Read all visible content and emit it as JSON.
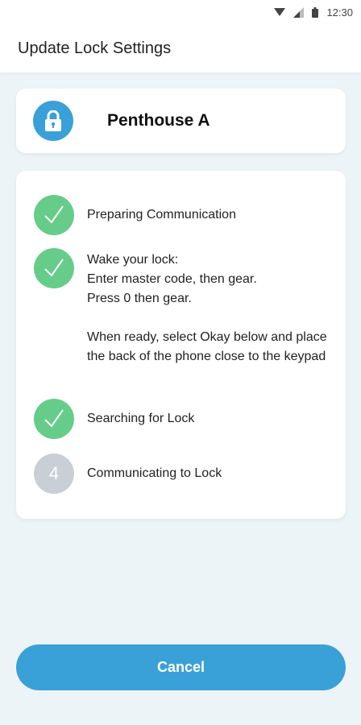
{
  "status_bar": {
    "time": "12:30",
    "icons": [
      "wifi-icon",
      "signal-icon",
      "battery-icon"
    ]
  },
  "header": {
    "title": "Update Lock Settings"
  },
  "lock": {
    "name": "Penthouse A",
    "icon": "lock-icon"
  },
  "steps": [
    {
      "state": "done",
      "text": "Preparing Communication"
    },
    {
      "state": "done",
      "text": "Wake your lock:\nEnter master code, then gear.\nPress 0 then gear.\n\nWhen ready, select Okay below and place the back of the phone close to the keypad"
    },
    {
      "state": "done",
      "text": "Searching for Lock"
    },
    {
      "state": "pending",
      "number": "4",
      "text": "Communicating to Lock"
    }
  ],
  "actions": {
    "cancel_label": "Cancel"
  },
  "colors": {
    "accent": "#3aa0d8",
    "success": "#66cc8a",
    "pending": "#c9cfd4",
    "background": "#edf4f7"
  }
}
